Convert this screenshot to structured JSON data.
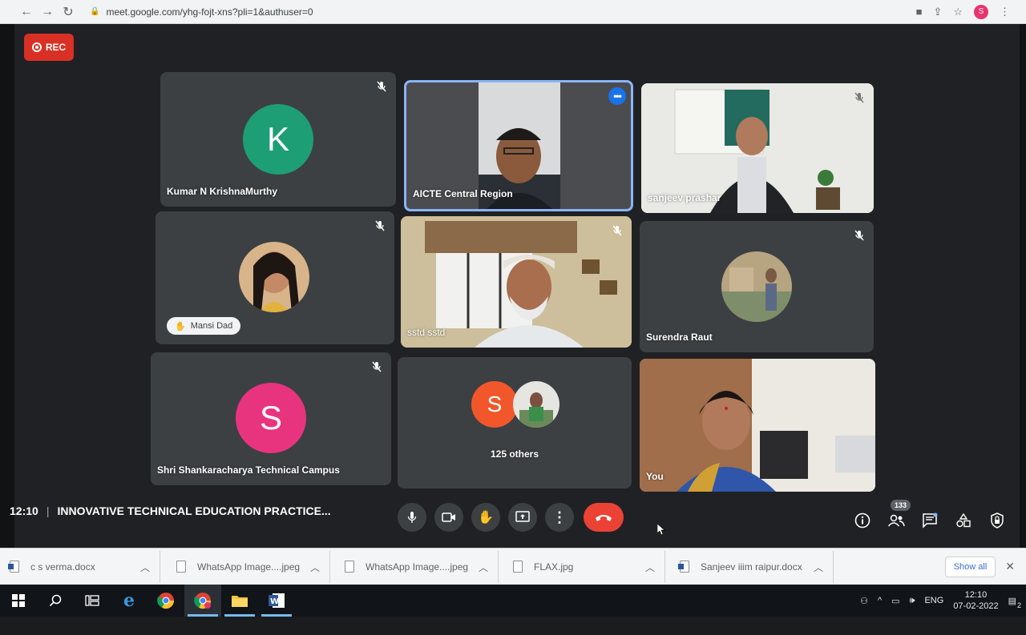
{
  "browser": {
    "url": "meet.google.com/yhg-fojt-xns?pli=1&authuser=0",
    "profile_initial": "S"
  },
  "meet": {
    "rec_label": "REC",
    "tiles": [
      {
        "name": "Kumar N KrishnaMurthy",
        "avatar_letter": "K",
        "avatar_color": "#1e9e75",
        "muted": true
      },
      {
        "name": "AICTE Central Region",
        "active": true
      },
      {
        "name": "sanjeev prashar",
        "muted": true
      },
      {
        "name": "Mansi Dad",
        "muted": true
      },
      {
        "name": "sstd sstd",
        "muted": true
      },
      {
        "name": "Surendra Raut",
        "muted": true
      },
      {
        "name": "Shri Shankaracharya Technical Campus",
        "avatar_letter": "S",
        "avatar_color": "#e8347f",
        "muted": true
      },
      {
        "name": "125 others",
        "avatar_letter": "S",
        "avatar_color": "#f2572b"
      },
      {
        "name": "You"
      }
    ],
    "time": "12:10",
    "meeting_title": "INNOVATIVE TECHNICAL EDUCATION PRACTICE...",
    "participant_count": "133"
  },
  "downloads": {
    "items": [
      {
        "name": "c s verma.docx",
        "type": "doc"
      },
      {
        "name": "WhatsApp Image....jpeg",
        "type": "img"
      },
      {
        "name": "WhatsApp Image....jpeg",
        "type": "img"
      },
      {
        "name": "FLAX.jpg",
        "type": "img"
      },
      {
        "name": "Sanjeev iiim raipur.docx",
        "type": "doc"
      }
    ],
    "show_all": "Show all"
  },
  "taskbar": {
    "lang": "ENG",
    "time": "12:10",
    "date": "07-02-2022",
    "notification_count": "2"
  },
  "colors": {
    "meet_bg": "#202124",
    "tile_bg": "#3c4043",
    "active_border": "#8ab4f8",
    "end_call": "#ea4335",
    "rec": "#d93025"
  }
}
